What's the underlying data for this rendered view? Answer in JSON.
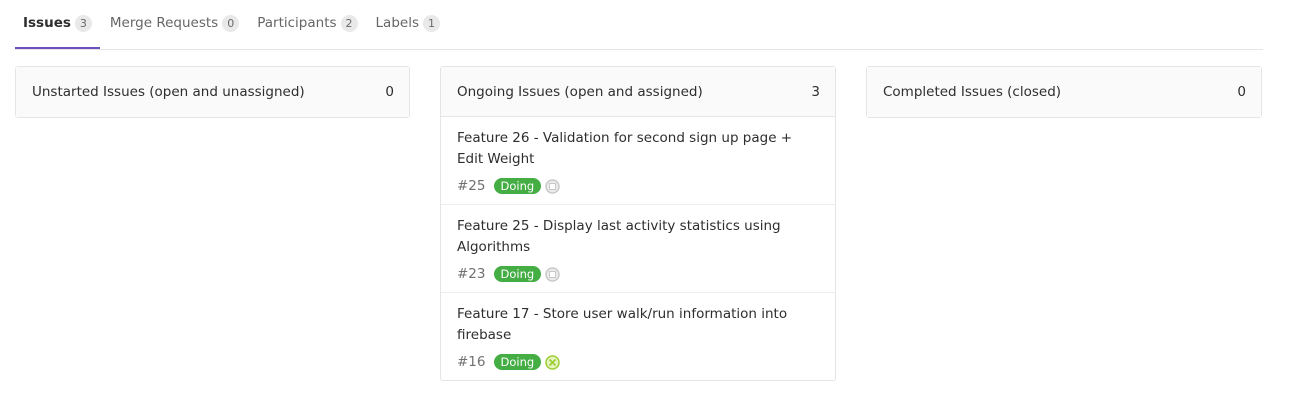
{
  "tabs": [
    {
      "label": "Issues",
      "count": "3"
    },
    {
      "label": "Merge Requests",
      "count": "0"
    },
    {
      "label": "Participants",
      "count": "2"
    },
    {
      "label": "Labels",
      "count": "1"
    }
  ],
  "columns": [
    {
      "title": "Unstarted Issues (open and unassigned)",
      "count": "0"
    },
    {
      "title": "Ongoing Issues (open and assigned)",
      "count": "3"
    },
    {
      "title": "Completed Issues (closed)",
      "count": "0"
    }
  ],
  "issues": [
    {
      "title": "Feature 26 - Validation for second sign up page + Edit Weight",
      "ref": "#25",
      "label": "Doing",
      "avatar_color": "#c8c8c8"
    },
    {
      "title": "Feature 25 - Display last activity statistics using Algorithms",
      "ref": "#23",
      "label": "Doing",
      "avatar_color": "#c8c8c8"
    },
    {
      "title": "Feature 17 - Store user walk/run information into firebase",
      "ref": "#16",
      "label": "Doing",
      "avatar_color": "#9acd32"
    }
  ],
  "colors": {
    "accent": "#6b4fbb",
    "label_doing": "#44ad44"
  }
}
